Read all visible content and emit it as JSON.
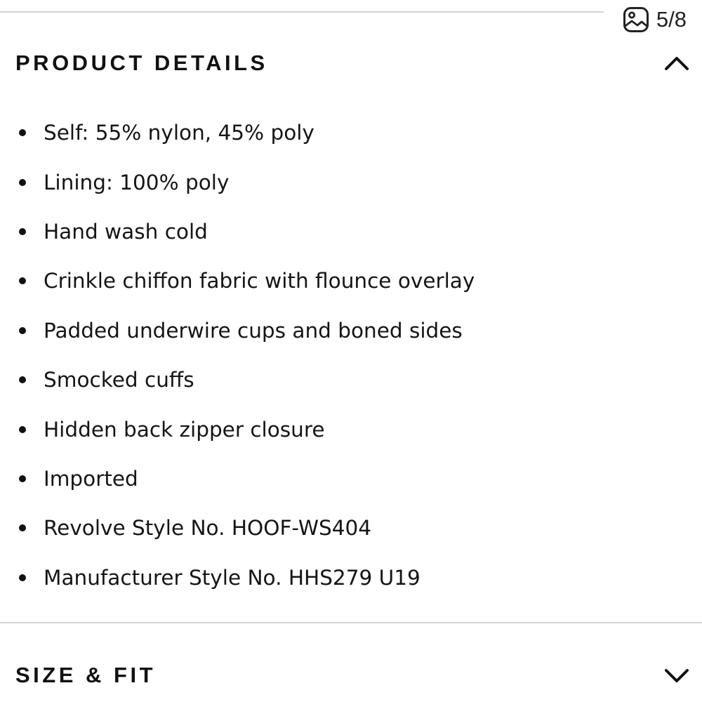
{
  "image_counter": {
    "icon": "image-icon",
    "text": "5/8"
  },
  "product_details": {
    "title": "PRODUCT DETAILS",
    "toggle_icon": "chevron-up-icon",
    "items": [
      "Self: 55% nylon, 45% poly",
      "Lining: 100% poly",
      "Hand wash cold",
      "Crinkle chiffon fabric with flounce overlay",
      "Padded underwire cups and boned sides",
      "Smocked cuffs",
      "Hidden back zipper closure",
      "Imported",
      "Revolve Style No. HOOF-WS404",
      "Manufacturer Style No. HHS279 U19"
    ]
  },
  "size_fit": {
    "title": "SIZE & FIT",
    "toggle_icon": "chevron-down-icon"
  }
}
